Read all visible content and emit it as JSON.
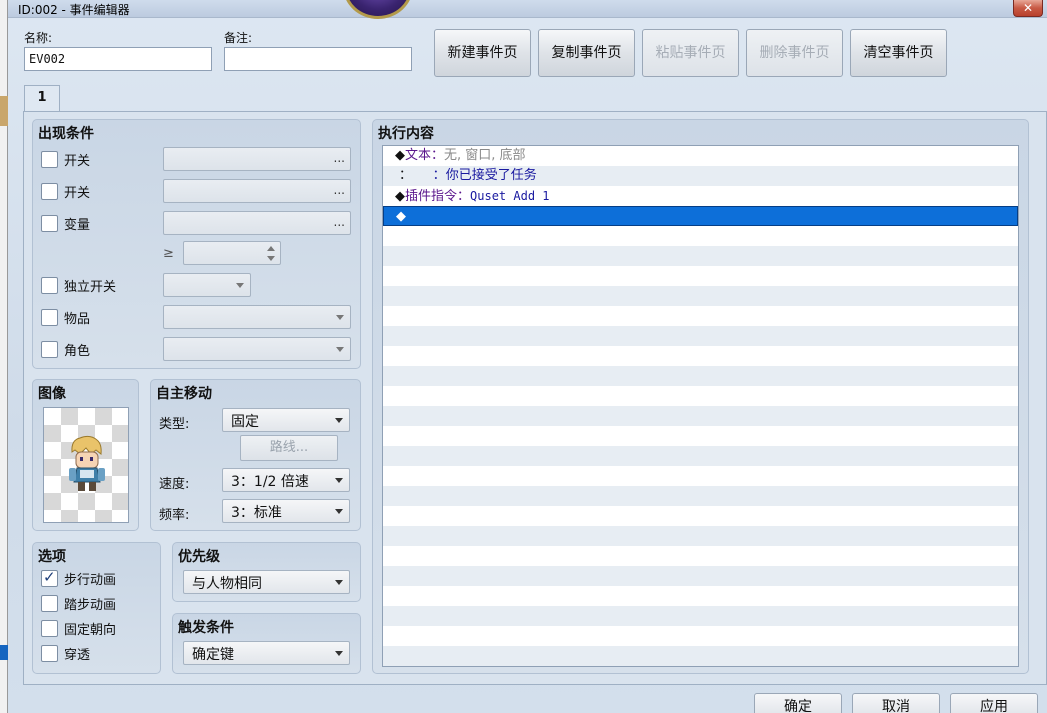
{
  "window": {
    "title": "ID:002 - 事件编辑器",
    "close_label": "✕"
  },
  "header": {
    "name_label": "名称:",
    "name_value": "EV002",
    "note_label": "备注:",
    "note_value": ""
  },
  "toolbar": {
    "new_page": "新建事件页",
    "copy_page": "复制事件页",
    "paste_page": "粘贴事件页",
    "delete_page": "删除事件页",
    "clear_page": "清空事件页"
  },
  "tabs": [
    {
      "label": "1"
    }
  ],
  "conditions": {
    "title": "出现条件",
    "switch1": {
      "label": "开关",
      "value": "...",
      "checked": false
    },
    "switch2": {
      "label": "开关",
      "value": "...",
      "checked": false
    },
    "variable": {
      "label": "变量",
      "value": "...",
      "checked": false
    },
    "compare_symbol": "≥",
    "self_switch": {
      "label": "独立开关",
      "checked": false
    },
    "item": {
      "label": "物品",
      "checked": false
    },
    "actor": {
      "label": "角色",
      "checked": false
    }
  },
  "image": {
    "title": "图像"
  },
  "autonomous": {
    "title": "自主移动",
    "type_label": "类型:",
    "type_value": "固定",
    "route_label": "路线...",
    "speed_label": "速度:",
    "speed_value": "3：1/2 倍速",
    "freq_label": "频率:",
    "freq_value": "3：标准"
  },
  "options": {
    "title": "选项",
    "walking": {
      "label": "步行动画",
      "checked": true
    },
    "stepping": {
      "label": "踏步动画",
      "checked": false
    },
    "direction_fix": {
      "label": "固定朝向",
      "checked": false
    },
    "through": {
      "label": "穿透",
      "checked": false
    }
  },
  "priority": {
    "title": "优先级",
    "value": "与人物相同"
  },
  "trigger": {
    "title": "触发条件",
    "value": "确定键"
  },
  "contents": {
    "title": "执行内容",
    "rows": [
      {
        "diamond": "◆",
        "head": "文本",
        "sep": "：",
        "rest": "无, 窗口, 底部"
      },
      {
        "prefix": "：",
        "spacer": "     ：",
        "text": "你已接受了任务"
      },
      {
        "diamond": "◆",
        "head": "插件指令",
        "sep": "：",
        "text": "Quset Add 1"
      },
      {
        "diamond": "◆"
      }
    ]
  },
  "footer": {
    "ok": "确定",
    "cancel": "取消",
    "apply": "应用"
  },
  "colors": {
    "selection": "#0d6fd9",
    "command_purple": "#5a168c",
    "text_blue": "#1a1aa0"
  }
}
